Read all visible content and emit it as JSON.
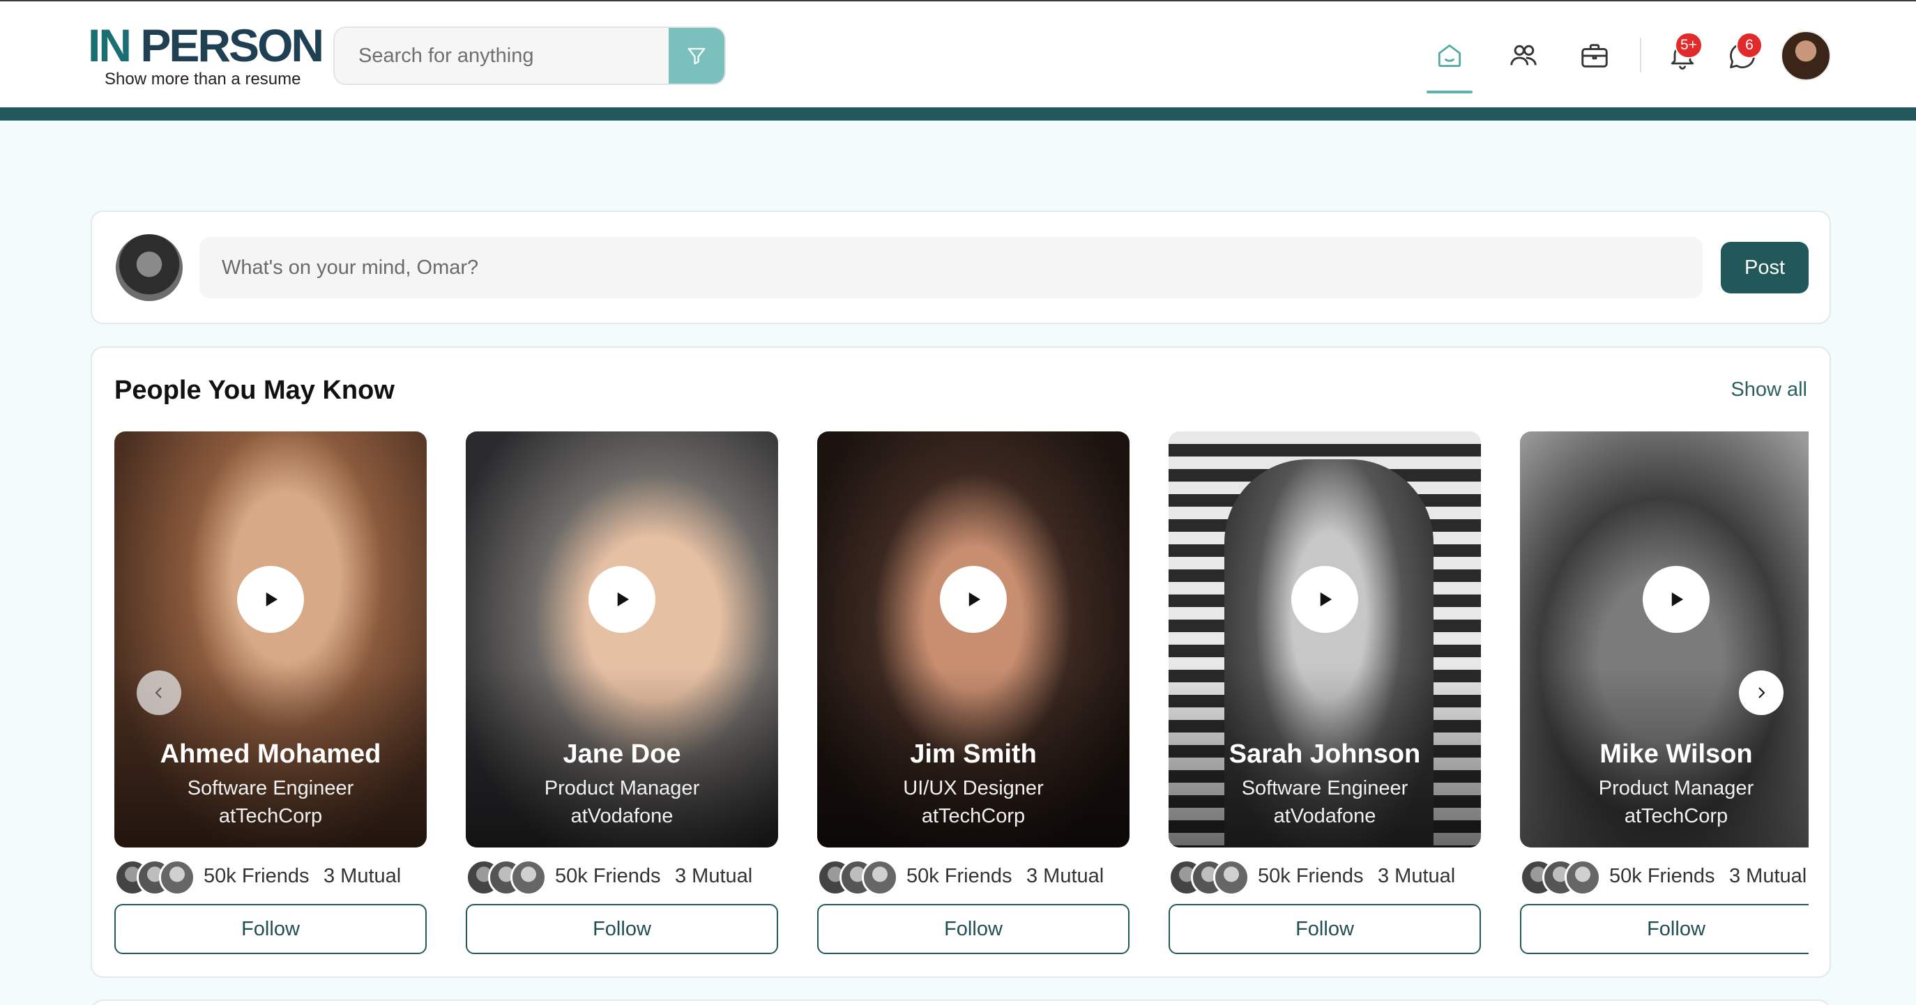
{
  "header": {
    "logo_in": "IN",
    "logo_person": " PERSON",
    "tagline": "Show more than a resume",
    "search_placeholder": "Search for anything",
    "notifications_badge": "5+",
    "messages_badge": "6"
  },
  "composer": {
    "placeholder": "What's on your mind, Omar?",
    "post_label": "Post"
  },
  "people_section": {
    "title": "People You May Know",
    "show_all": "Show all",
    "people": [
      {
        "name": "Ahmed Mohamed",
        "role": "Software Engineer",
        "company": "atTechCorp",
        "friends": "50k Friends",
        "mutual": "3 Mutual",
        "follow": "Follow"
      },
      {
        "name": "Jane Doe",
        "role": "Product Manager",
        "company": "atVodafone",
        "friends": "50k Friends",
        "mutual": "3 Mutual",
        "follow": "Follow"
      },
      {
        "name": "Jim Smith",
        "role": "UI/UX Designer",
        "company": "atTechCorp",
        "friends": "50k Friends",
        "mutual": "3 Mutual",
        "follow": "Follow"
      },
      {
        "name": "Sarah Johnson",
        "role": "Software Engineer",
        "company": "atVodafone",
        "friends": "50k Friends",
        "mutual": "3 Mutual",
        "follow": "Follow"
      },
      {
        "name": "Mike Wilson",
        "role": "Product Manager",
        "company": "atTechCorp",
        "friends": "50k Friends",
        "mutual": "3 Mutual",
        "follow": "Follow"
      }
    ]
  },
  "colors": {
    "brand_dark": "#22585a",
    "brand_light": "#7ac1bd",
    "badge": "#e22a2a",
    "page_bg": "#f3fcfc"
  },
  "icons": [
    "filter-icon",
    "home-icon",
    "people-icon",
    "briefcase-icon",
    "bell-icon",
    "chat-icon",
    "play-icon",
    "chevron-left-icon",
    "chevron-right-icon"
  ]
}
